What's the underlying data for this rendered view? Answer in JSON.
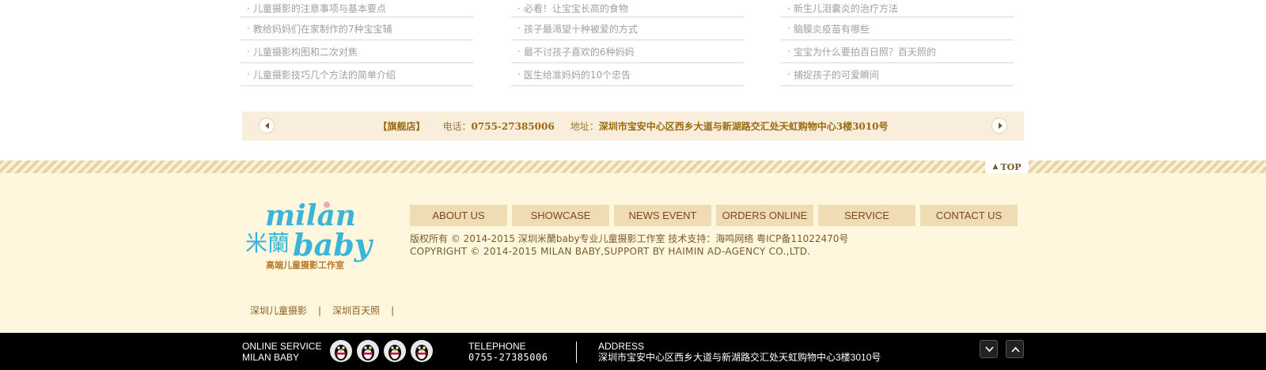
{
  "articles": [
    {
      "items": [
        "儿童摄影的注意事项与基本要点",
        "教给妈妈们在家制作的7种宝宝辅",
        "儿童摄影构图和二次对焦",
        "儿童摄影技巧几个方法的简单介绍"
      ]
    },
    {
      "items": [
        "必看！让宝宝长高的食物",
        "孩子最渴望十种被爱的方式",
        "最不讨孩子喜欢的6种妈妈",
        "医生给准妈妈的10个忠告"
      ]
    },
    {
      "items": [
        "新生儿泪囊炎的治疗方法",
        "脑膜炎疫苗有哪些",
        "宝宝为什么要拍百日照？百天照的",
        "捕捉孩子的可爱瞬间"
      ]
    }
  ],
  "bullet": "·",
  "info_strip": {
    "store": "【旗舰店】",
    "tel_label": "电话：",
    "tel": "0755-27385006",
    "addr_label": "地址：",
    "addr": "深圳市宝安中心区西乡大道与新湖路交汇处天虹购物中心3楼3010号"
  },
  "top_label": "TOP",
  "logo": {
    "wordmark_top": "milan",
    "wordmark_bottom": "baby",
    "cn_name": "米蘭",
    "tagline": "高端儿童摄影工作室"
  },
  "nav": [
    "ABOUT US",
    "SHOWCASE",
    "NEWS EVENT",
    "ORDERS ONLINE",
    "SERVICE",
    "CONTACT US"
  ],
  "copyright_cn": "版权所有 © 2014-2015 深圳米蘭baby专业儿童摄影工作室 技术支持：海鸣网络 粤ICP备11022470号",
  "copyright_en": "COPYRIGHT © 2014-2015 MILAN BABY,SUPPORT BY HAIMIN AD-AGENCY CO.,LTD.",
  "links": [
    "深圳儿童摄影",
    "深圳百天照"
  ],
  "link_sep": "|",
  "bottom_bar": {
    "service_line1": "ONLINE SERVICE",
    "service_line2": "MILAN BABY",
    "tel_title": "TELEPHONE",
    "tel_value": "0755-27385006",
    "addr_title": "ADDRESS",
    "addr_value": "深圳市宝安中心区西乡大道与新湖路交汇处天虹购物中心3楼3010号"
  },
  "colors": {
    "strip_bg": "#f8eedb",
    "footer_bg": "#fef7dd",
    "nav_bg": "#efdcb4",
    "logo_blue": "#3ab4d8",
    "brand_brown": "#9b6a10"
  }
}
